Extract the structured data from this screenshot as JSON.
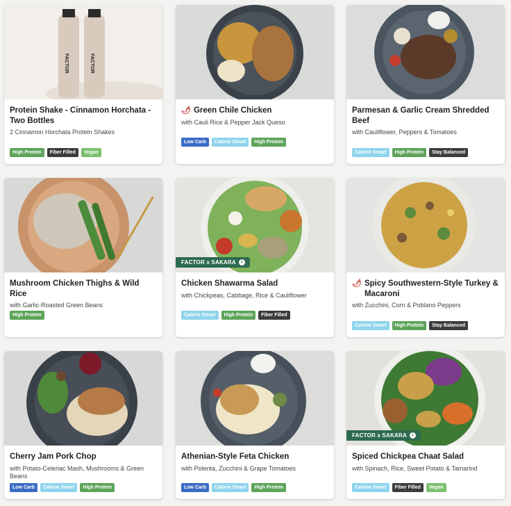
{
  "colors": {
    "high_protein": "#5da35a",
    "fiber_filled": "#3c3c3c",
    "vegan": "#7cc06f",
    "calorie_smart": "#8fd4ec",
    "low_carb": "#3b6cc4",
    "stay_balanced": "#3c3c3c",
    "partner_badge": "#2d6a4f"
  },
  "cards": [
    {
      "title": "Protein Shake - Cinnamon Horchata - Two Bottles",
      "subtitle": "2 Cinnamon Horchata Protein Shakes",
      "spicy": false,
      "tags": [
        "High Protein",
        "Fiber Filled",
        "Vegan"
      ],
      "bottle_brand": "FACTOR"
    },
    {
      "title": "Green Chile Chicken",
      "subtitle": "with Cauli Rice & Pepper Jack Queso",
      "spicy": true,
      "tags": [
        "Low Carb",
        "Calorie Smart",
        "High Protein"
      ]
    },
    {
      "title": "Parmesan & Garlic Cream Shredded Beef",
      "subtitle": "with Cauliflower, Peppers & Tomatoes",
      "spicy": false,
      "tags": [
        "Calorie Smart",
        "High Protein",
        "Stay Balanced"
      ]
    },
    {
      "title": "Mushroom Chicken Thighs & Wild Rice",
      "subtitle": "with Garlic-Roasted Green Beans",
      "spicy": false,
      "tags": [
        "High Protein"
      ]
    },
    {
      "title": "Chicken Shawarma Salad",
      "subtitle": "with Chickpeas, Cabbage, Rice & Cauliflower",
      "spicy": false,
      "partner": "FACTOR x SAKARA",
      "tags": [
        "Calorie Smart",
        "High Protein",
        "Fiber Filled"
      ]
    },
    {
      "title": "Spicy Southwestern-Style Turkey & Macaroni",
      "subtitle": "with Zucchini, Corn & Poblano Peppers",
      "spicy": true,
      "tags": [
        "Calorie Smart",
        "High Protein",
        "Stay Balanced"
      ]
    },
    {
      "title": "Cherry Jam Pork Chop",
      "subtitle": "with Potato-Celeriac Mash, Mushrooms & Green Beans",
      "spicy": false,
      "tags": [
        "Low Carb",
        "Calorie Smart",
        "High Protein"
      ]
    },
    {
      "title": "Athenian-Style Feta Chicken",
      "subtitle": "with Polenta, Zucchini & Grape Tomatoes",
      "spicy": false,
      "tags": [
        "Low Carb",
        "Calorie Smart",
        "High Protein"
      ]
    },
    {
      "title": "Spiced Chickpea Chaat Salad",
      "subtitle": "with Spinach, Rice, Sweet Potato & Tamarind",
      "spicy": false,
      "partner": "FACTOR x SAKARA",
      "tags": [
        "Calorie Smart",
        "Fiber Filled",
        "Vegan"
      ]
    }
  ],
  "icons": {
    "spicy": "chili-pepper-icon",
    "info": "info-icon"
  }
}
